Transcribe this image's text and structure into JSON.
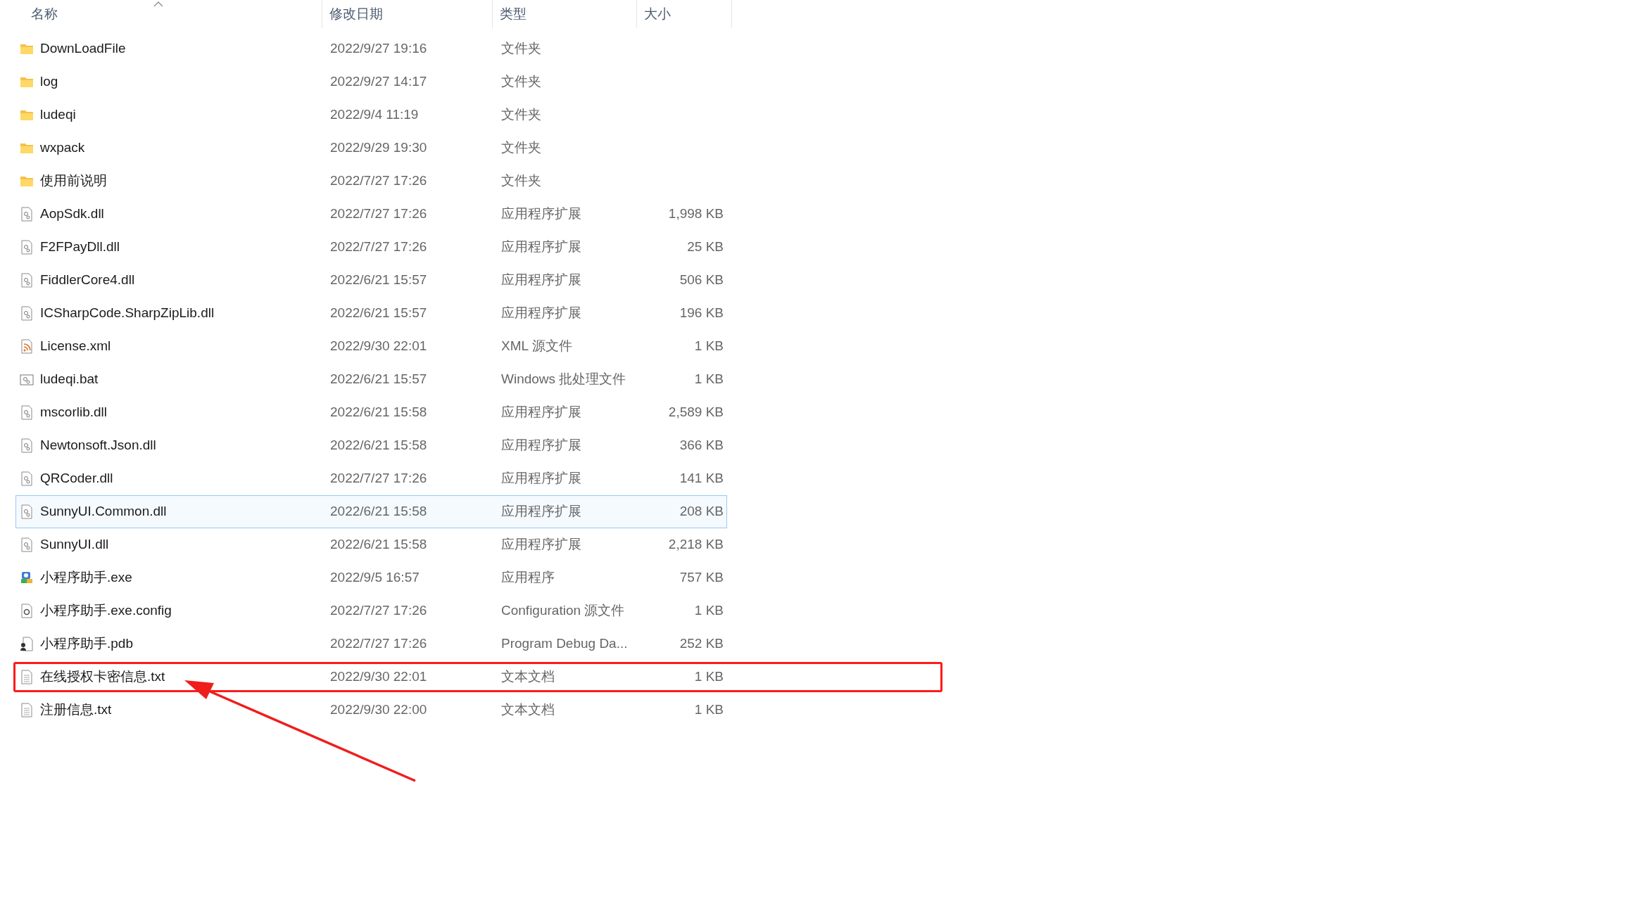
{
  "columns": [
    {
      "label": "名称",
      "sorted": true
    },
    {
      "label": "修改日期",
      "sorted": false
    },
    {
      "label": "类型",
      "sorted": false
    },
    {
      "label": "大小",
      "sorted": false
    }
  ],
  "rows": [
    {
      "name": "DownLoadFile",
      "date": "2022/9/27 19:16",
      "type": "文件夹",
      "kind": "folder",
      "hovered": false,
      "annotated": false
    },
    {
      "name": "log",
      "date": "2022/9/27 14:17",
      "type": "文件夹",
      "kind": "folder",
      "hovered": false,
      "annotated": false
    },
    {
      "name": "ludeqi",
      "date": "2022/9/4 11:19",
      "type": "文件夹",
      "kind": "folder",
      "hovered": false,
      "annotated": false
    },
    {
      "name": "wxpack",
      "date": "2022/9/29 19:30",
      "type": "文件夹",
      "kind": "folder",
      "hovered": false,
      "annotated": false
    },
    {
      "name": "使用前说明",
      "date": "2022/7/27 17:26",
      "type": "文件夹",
      "kind": "folder",
      "hovered": false,
      "annotated": false
    },
    {
      "name": "AopSdk.dll",
      "date": "2022/7/27 17:26",
      "type": "应用程序扩展",
      "size": "1,998 KB",
      "kind": "dll",
      "hovered": false,
      "annotated": false
    },
    {
      "name": "F2FPayDll.dll",
      "date": "2022/7/27 17:26",
      "type": "应用程序扩展",
      "size": "25 KB",
      "kind": "dll",
      "hovered": false,
      "annotated": false
    },
    {
      "name": "FiddlerCore4.dll",
      "date": "2022/6/21 15:57",
      "type": "应用程序扩展",
      "size": "506 KB",
      "kind": "dll",
      "hovered": false,
      "annotated": false
    },
    {
      "name": "ICSharpCode.SharpZipLib.dll",
      "date": "2022/6/21 15:57",
      "type": "应用程序扩展",
      "size": "196 KB",
      "kind": "dll",
      "hovered": false,
      "annotated": false
    },
    {
      "name": "License.xml",
      "date": "2022/9/30 22:01",
      "type": "XML 源文件",
      "size": "1 KB",
      "kind": "xml",
      "hovered": false,
      "annotated": false
    },
    {
      "name": "ludeqi.bat",
      "date": "2022/6/21 15:57",
      "type": "Windows 批处理文件",
      "size": "1 KB",
      "kind": "bat",
      "hovered": false,
      "annotated": false
    },
    {
      "name": "mscorlib.dll",
      "date": "2022/6/21 15:58",
      "type": "应用程序扩展",
      "size": "2,589 KB",
      "kind": "dll",
      "hovered": false,
      "annotated": false
    },
    {
      "name": "Newtonsoft.Json.dll",
      "date": "2022/6/21 15:58",
      "type": "应用程序扩展",
      "size": "366 KB",
      "kind": "dll",
      "hovered": false,
      "annotated": false
    },
    {
      "name": "QRCoder.dll",
      "date": "2022/7/27 17:26",
      "type": "应用程序扩展",
      "size": "141 KB",
      "kind": "dll",
      "hovered": false,
      "annotated": false
    },
    {
      "name": "SunnyUI.Common.dll",
      "date": "2022/6/21 15:58",
      "type": "应用程序扩展",
      "size": "208 KB",
      "kind": "dll",
      "hovered": true,
      "annotated": false
    },
    {
      "name": "SunnyUI.dll",
      "date": "2022/6/21 15:58",
      "type": "应用程序扩展",
      "size": "2,218 KB",
      "kind": "dll",
      "hovered": false,
      "annotated": false
    },
    {
      "name": "小程序助手.exe",
      "date": "2022/9/5 16:57",
      "type": "应用程序",
      "size": "757 KB",
      "kind": "exe",
      "hovered": false,
      "annotated": false
    },
    {
      "name": "小程序助手.exe.config",
      "date": "2022/7/27 17:26",
      "type": "Configuration 源文件",
      "size": "1 KB",
      "kind": "config",
      "hovered": false,
      "annotated": false
    },
    {
      "name": "小程序助手.pdb",
      "date": "2022/7/27 17:26",
      "type": "Program Debug Da...",
      "size": "252 KB",
      "kind": "pdb",
      "hovered": false,
      "annotated": false
    },
    {
      "name": "在线授权卡密信息.txt",
      "date": "2022/9/30 22:01",
      "type": "文本文档",
      "size": "1 KB",
      "kind": "txt",
      "hovered": false,
      "annotated": true
    },
    {
      "name": "注册信息.txt",
      "date": "2022/9/30 22:00",
      "type": "文本文档",
      "size": "1 KB",
      "kind": "txt",
      "hovered": false,
      "annotated": false
    }
  ]
}
